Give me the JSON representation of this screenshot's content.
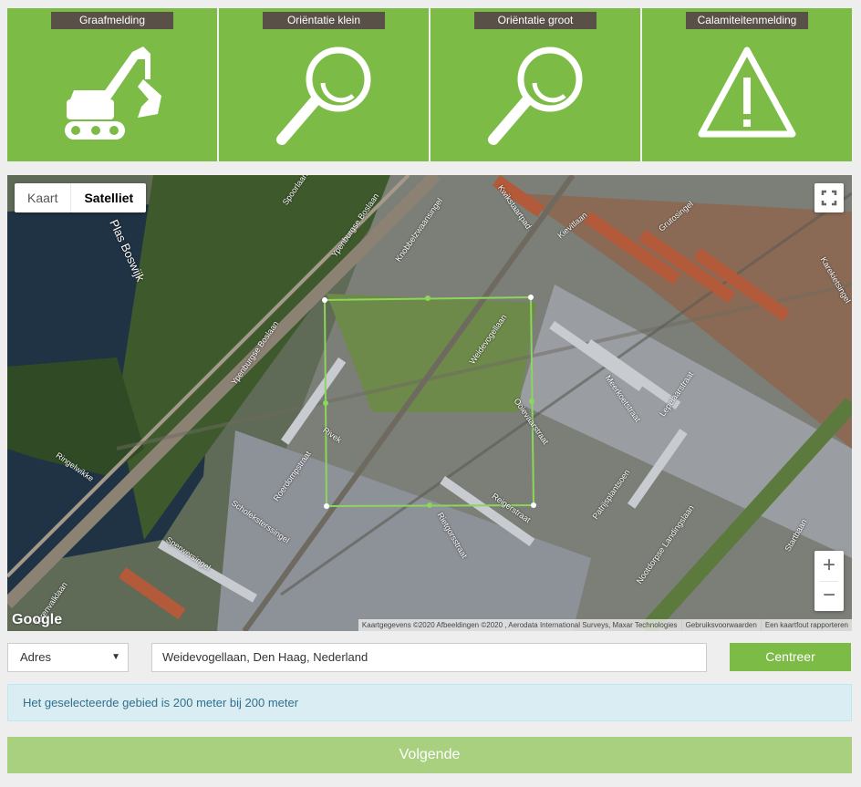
{
  "tiles": [
    {
      "label": "Graafmelding",
      "icon": "excavator-icon"
    },
    {
      "label": "Oriëntatie klein",
      "icon": "magnifier-icon"
    },
    {
      "label": "Oriëntatie groot",
      "icon": "magnifier-icon"
    },
    {
      "label": "Calamiteitenmelding",
      "icon": "warning-icon"
    }
  ],
  "map": {
    "type_buttons": {
      "map": "Kaart",
      "satellite": "Satelliet",
      "active": "Satelliet"
    },
    "logo": "Google",
    "attribution": [
      "Kaartgegevens ©2020 Afbeeldingen ©2020 , Aerodata International Surveys, Maxar Technologies",
      "Gebruiksvoorwaarden",
      "Een kaartfout rapporteren"
    ],
    "zoom_in": "+",
    "zoom_out": "−",
    "labels": {
      "lake": "Plas Boswijk",
      "road1": "Ypenburgse Boslaan",
      "road2": "Ypenburgse Boslaan",
      "road3": "Weidevogellaan",
      "road4": "Ooievaarstraat",
      "road5": "Meerkoetstraat",
      "road6": "Lepelaarstraat",
      "road7": "Reigerstraat",
      "road8": "Rietgorsstraat",
      "road9": "Scholeksterssingel",
      "road10": "Sperwersingel",
      "road11": "Nootdorpse Landingslaan",
      "road12": "Startbaan",
      "road13": "Ringelwikke",
      "road14": "Kwikstaartpad",
      "road15": "Knobbelzwaansingel",
      "road16": "Karekietsingel",
      "road17": "Grutosingel",
      "road18": "Patrijsplantsoen",
      "road19": "Roerdompstraat",
      "road20": "Torenvalklaan",
      "road21": "Spoorlaan",
      "road22": "Kievitlaan",
      "road23": "Rivek"
    },
    "selection_color": "#8cd65a"
  },
  "search": {
    "mode_label": "Adres",
    "caret": "▼",
    "address_value": "Weidevogellaan, Den Haag, Nederland",
    "center_button": "Centreer"
  },
  "info_text": "Het geselecteerde gebied is 200 meter bij 200 meter",
  "next_button": "Volgende",
  "colors": {
    "accent": "#7dbb47",
    "label_bg": "#595047",
    "info_bg": "#d9edf2",
    "info_text": "#31708f",
    "next_disabled": "#a8d07f"
  }
}
